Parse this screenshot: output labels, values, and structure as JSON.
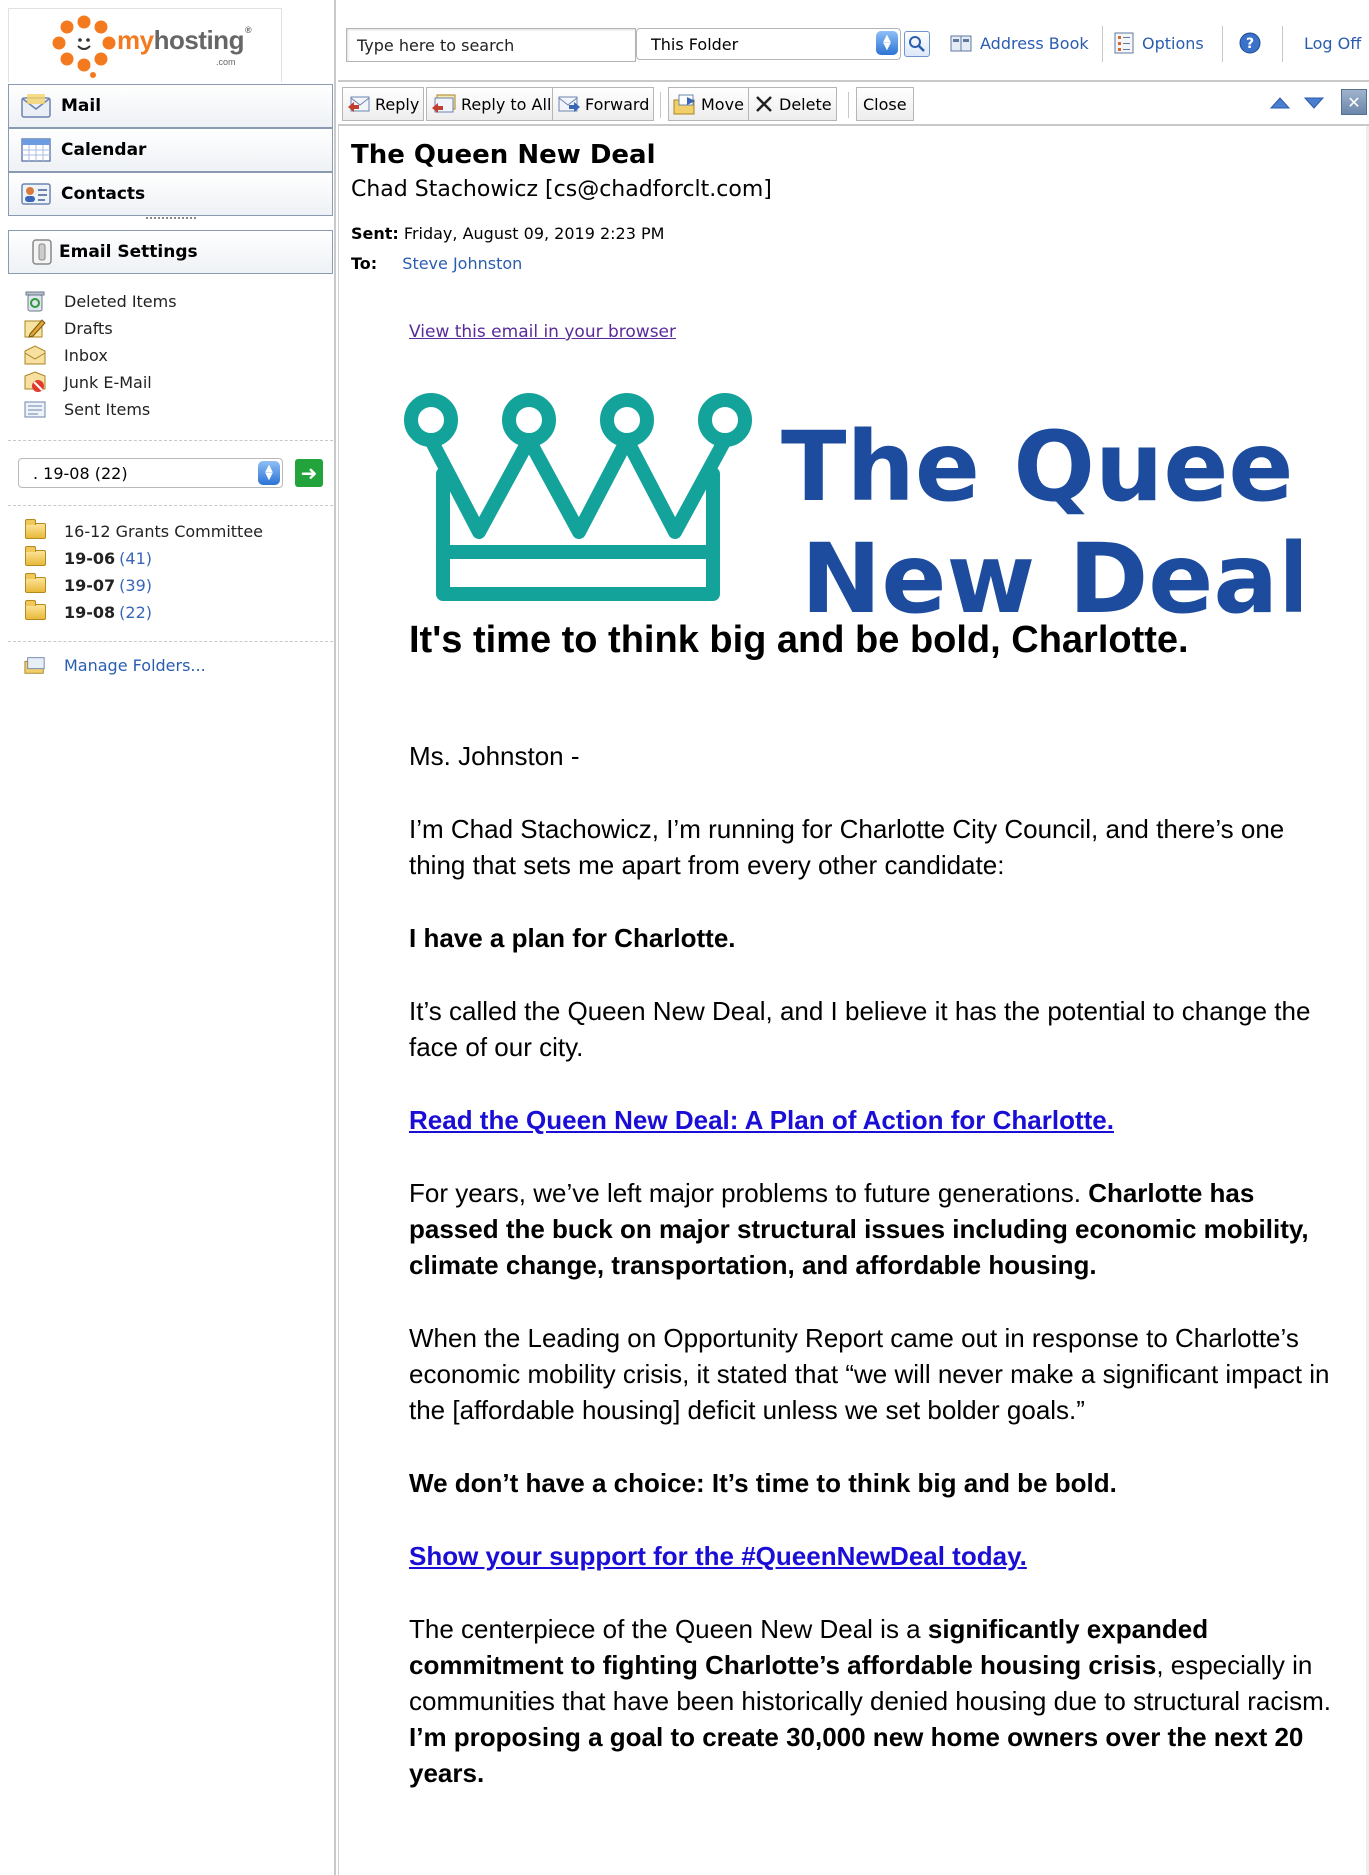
{
  "logo": {
    "brand_my": "my",
    "brand_rest": "hosting",
    "reg": "®",
    "tld": ".com"
  },
  "nav": {
    "mail": "Mail",
    "calendar": "Calendar",
    "contacts": "Contacts",
    "email_settings": "Email Settings"
  },
  "folders": [
    {
      "label": "Deleted Items",
      "icon": "recycle-bin-icon"
    },
    {
      "label": "Drafts",
      "icon": "draft-pencil-icon"
    },
    {
      "label": "Inbox",
      "icon": "inbox-icon"
    },
    {
      "label": "Junk E-Mail",
      "icon": "junk-mail-icon"
    },
    {
      "label": "Sent Items",
      "icon": "sent-items-icon"
    }
  ],
  "folder_select": {
    "value": ". 19-08 (22)"
  },
  "subfolders": [
    {
      "label": "16-12 Grants Committee",
      "count": "",
      "bold": false
    },
    {
      "label": "19-06",
      "count": "(41)",
      "bold": true
    },
    {
      "label": "19-07",
      "count": "(39)",
      "bold": true
    },
    {
      "label": "19-08",
      "count": "(22)",
      "bold": true
    }
  ],
  "manage_folders": "Manage Folders...",
  "search": {
    "placeholder": "Type here to search",
    "scope": "This Folder"
  },
  "toplinks": {
    "address_book": "Address Book",
    "options": "Options",
    "logoff": "Log Off"
  },
  "toolbar": {
    "reply": "Reply",
    "reply_all": "Reply to All",
    "forward": "Forward",
    "move": "Move",
    "delete": "Delete",
    "close": "Close"
  },
  "message": {
    "subject": "The Queen New Deal",
    "from": "Chad Stachowicz [cs@chadforclt.com]",
    "sent_label": "Sent:",
    "sent_value": "Friday, August 09, 2019 2:23 PM",
    "to_label": "To:",
    "to_value": "Steve Johnston",
    "view_in_browser": "View this email in your browser",
    "banner_line1": "The Queen",
    "banner_line2": "New Deal",
    "headline": "It's time to think big and be bold, Charlotte.",
    "salutation": "Ms. Johnston -",
    "p1": "I’m Chad Stachowicz, I’m running for Charlotte City Council, and there’s one thing that sets me apart from every other candidate:",
    "p2": "I have a plan for Charlotte.",
    "p3": "It’s called the Queen New Deal, and I believe it has the potential to change the face of our city.",
    "link1": "Read the Queen New Deal: A Plan of Action for Charlotte.",
    "p4a": "For years, we’ve left major problems to future generations. ",
    "p4b": "Charlotte has passed the buck on major structural issues including economic mobility, climate change, transportation, and affordable housing.",
    "p5": "When the Leading on Opportunity Report came out in response to Charlotte’s economic mobility crisis, it stated that “we will never make a significant impact in the [affordable housing] deficit unless we set bolder goals.”",
    "p6": "We don’t have a choice: It’s time to think big and be bold.",
    "link2": "Show your support for the #QueenNewDeal today.",
    "p7a": "The centerpiece of the Queen New Deal is a ",
    "p7b": "significantly expanded commitment to fighting Charlotte’s affordable housing crisis",
    "p7c": ", especially in communities that have been historically denied housing due to structural racism. ",
    "p7d": "I’m proposing a goal to create 30,000 new home owners over the next 20 years."
  },
  "colors": {
    "crown": "#13a39a",
    "banner_text": "#1d4c9e",
    "link": "#1a0dd6",
    "ui_link": "#2a5db0",
    "logo_orange": "#f47a20"
  }
}
